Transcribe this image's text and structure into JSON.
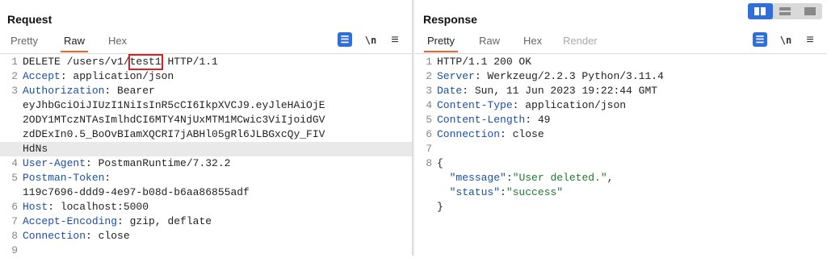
{
  "request": {
    "title": "Request",
    "tabs": [
      "Pretty",
      "Raw",
      "Hex"
    ],
    "active_tab": "Raw",
    "tool_wrap_icon": "wrap-lines-icon",
    "tool_newline": "\\n",
    "lines": [
      {
        "n": "1",
        "segs": [
          {
            "t": "DELETE /users/v1/",
            "c": "plain"
          },
          {
            "t": "test1",
            "c": "boxed"
          },
          {
            "t": " HTTP/1.1",
            "c": "plain"
          }
        ]
      },
      {
        "n": "2",
        "segs": [
          {
            "t": "Accept",
            "c": "key"
          },
          {
            "t": ": application/json",
            "c": "plain"
          }
        ]
      },
      {
        "n": "3",
        "segs": [
          {
            "t": "Authorization",
            "c": "key"
          },
          {
            "t": ": Bearer",
            "c": "plain"
          }
        ]
      },
      {
        "n": "",
        "segs": [
          {
            "t": "eyJhbGciOiJIUzI1NiIsInR5cCI6IkpXVCJ9.eyJleHAiOjE",
            "c": "plain"
          }
        ]
      },
      {
        "n": "",
        "segs": [
          {
            "t": "2ODY1MTczNTAsImlhdCI6MTY4NjUxMTM1MCwic3ViIjoidGV",
            "c": "plain"
          }
        ]
      },
      {
        "n": "",
        "segs": [
          {
            "t": "zdDExIn0.5_BoOvBIamXQCRI7jABHl05gRl6JLBGxcQy_FIV",
            "c": "plain"
          }
        ]
      },
      {
        "n": "",
        "segs": [
          {
            "t": "HdNs",
            "c": "plain"
          }
        ],
        "hl": true
      },
      {
        "n": "4",
        "segs": [
          {
            "t": "User-Agent",
            "c": "key"
          },
          {
            "t": ": PostmanRuntime/7.32.2",
            "c": "plain"
          }
        ]
      },
      {
        "n": "5",
        "segs": [
          {
            "t": "Postman-Token",
            "c": "key"
          },
          {
            "t": ":",
            "c": "plain"
          }
        ]
      },
      {
        "n": "",
        "segs": [
          {
            "t": "119c7696-ddd9-4e97-b08d-b6aa86855adf",
            "c": "plain"
          }
        ]
      },
      {
        "n": "6",
        "segs": [
          {
            "t": "Host",
            "c": "key"
          },
          {
            "t": ": localhost:5000",
            "c": "plain"
          }
        ]
      },
      {
        "n": "7",
        "segs": [
          {
            "t": "Accept-Encoding",
            "c": "key"
          },
          {
            "t": ": gzip, deflate",
            "c": "plain"
          }
        ]
      },
      {
        "n": "8",
        "segs": [
          {
            "t": "Connection",
            "c": "key"
          },
          {
            "t": ": close",
            "c": "plain"
          }
        ]
      },
      {
        "n": "9",
        "segs": []
      }
    ]
  },
  "response": {
    "title": "Response",
    "tabs": [
      "Pretty",
      "Raw",
      "Hex",
      "Render"
    ],
    "active_tab": "Pretty",
    "tool_newline": "\\n",
    "lines": [
      {
        "n": "1",
        "segs": [
          {
            "t": "HTTP/1.1 200 OK",
            "c": "plain"
          }
        ]
      },
      {
        "n": "2",
        "segs": [
          {
            "t": "Server",
            "c": "key"
          },
          {
            "t": ": Werkzeug/2.2.3 Python/3.11.4",
            "c": "plain"
          }
        ]
      },
      {
        "n": "3",
        "segs": [
          {
            "t": "Date",
            "c": "key"
          },
          {
            "t": ": Sun, 11 Jun 2023 19:22:44 GMT",
            "c": "plain"
          }
        ]
      },
      {
        "n": "4",
        "segs": [
          {
            "t": "Content-Type",
            "c": "key"
          },
          {
            "t": ": application/json",
            "c": "plain"
          }
        ]
      },
      {
        "n": "5",
        "segs": [
          {
            "t": "Content-Length",
            "c": "key"
          },
          {
            "t": ": 49",
            "c": "plain"
          }
        ]
      },
      {
        "n": "6",
        "segs": [
          {
            "t": "Connection",
            "c": "key"
          },
          {
            "t": ": close",
            "c": "plain"
          }
        ]
      },
      {
        "n": "7",
        "segs": []
      },
      {
        "n": "8",
        "segs": [
          {
            "t": "{",
            "c": "plain"
          }
        ]
      },
      {
        "n": "",
        "segs": [
          {
            "t": "  \"message\"",
            "c": "key"
          },
          {
            "t": ":",
            "c": "plain"
          },
          {
            "t": "\"User deleted.\"",
            "c": "str"
          },
          {
            "t": ",",
            "c": "plain"
          }
        ]
      },
      {
        "n": "",
        "segs": [
          {
            "t": "  \"status\"",
            "c": "key"
          },
          {
            "t": ":",
            "c": "plain"
          },
          {
            "t": "\"success\"",
            "c": "str"
          }
        ]
      },
      {
        "n": "",
        "segs": [
          {
            "t": "}",
            "c": "plain"
          }
        ]
      }
    ]
  },
  "layout_controls": [
    {
      "name": "split-vertical-icon",
      "active": true
    },
    {
      "name": "split-horizontal-icon",
      "active": false
    },
    {
      "name": "single-pane-icon",
      "active": false
    }
  ],
  "colors": {
    "accent": "#e8662d",
    "button_blue": "#2f6fd8",
    "key": "#1a4fa8",
    "string": "#1e7a2f",
    "highlight_box": "#e02020"
  }
}
